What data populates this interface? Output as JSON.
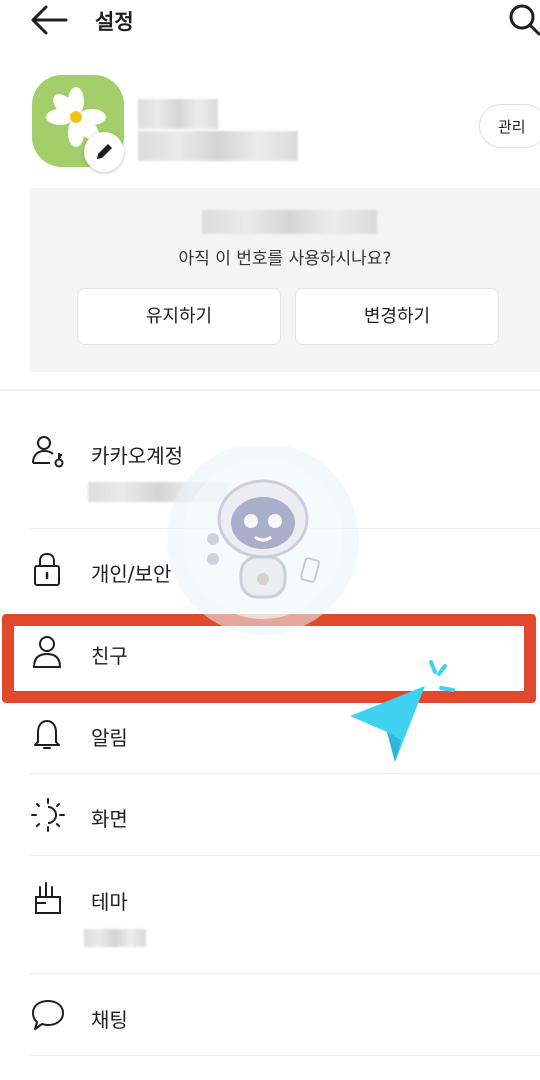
{
  "header": {
    "title": "설정"
  },
  "profile": {
    "manage_label": "관리"
  },
  "number_prompt": {
    "question": "아직 이 번호를 사용하시나요?",
    "keep_label": "유지하기",
    "change_label": "변경하기"
  },
  "menu": {
    "items": [
      {
        "label": "카카오계정",
        "icon": "account-key-icon"
      },
      {
        "label": "개인/보안",
        "icon": "lock-icon"
      },
      {
        "label": "친구",
        "icon": "person-icon"
      },
      {
        "label": "알림",
        "icon": "bell-icon"
      },
      {
        "label": "화면",
        "icon": "brightness-icon"
      },
      {
        "label": "테마",
        "icon": "brush-icon"
      },
      {
        "label": "채팅",
        "icon": "chat-bubble-icon"
      }
    ]
  },
  "colors": {
    "highlight": "#e0492c",
    "cursor": "#3fd2f0",
    "profile_bg": "#a3cf6a"
  }
}
